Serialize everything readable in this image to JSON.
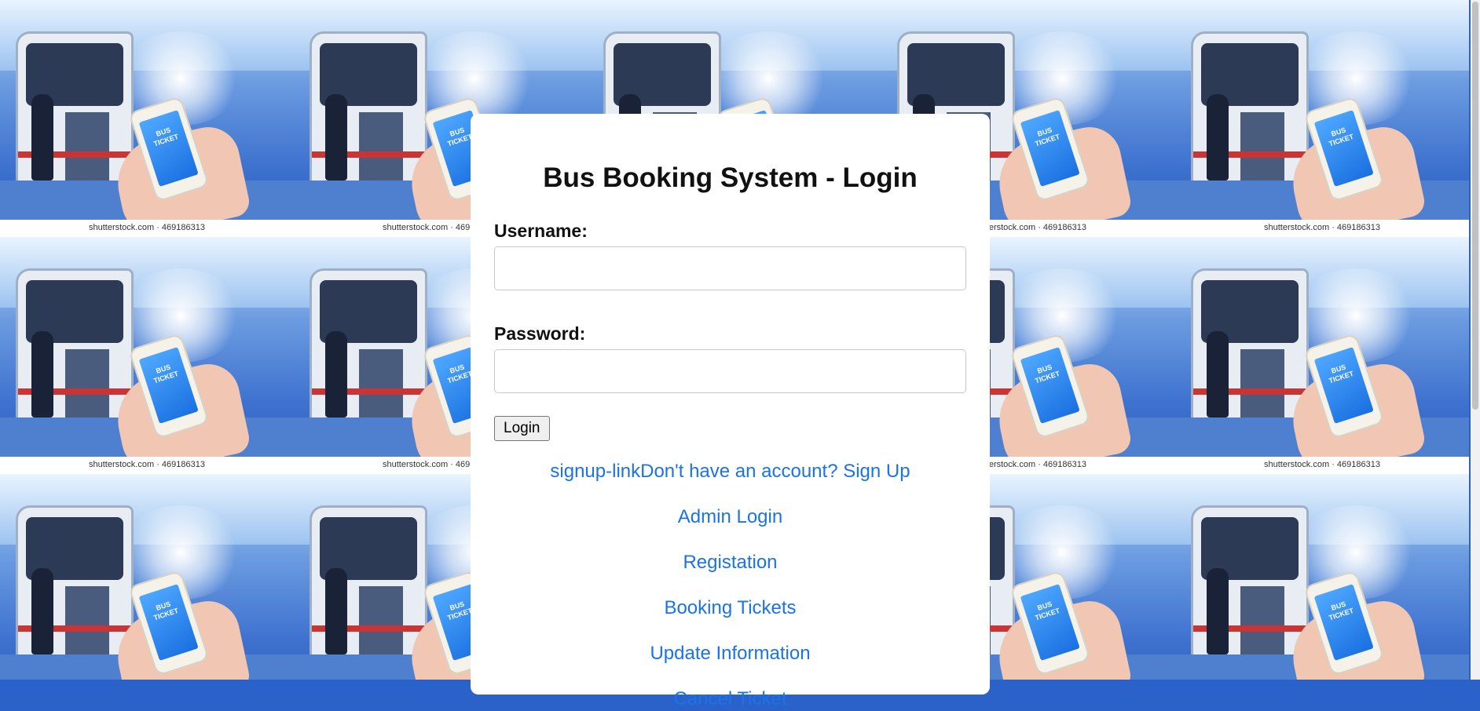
{
  "background": {
    "tile_caption": "shutterstock.com · 469186313",
    "phone_text": "BUS TICKET"
  },
  "login": {
    "title": "Bus Booking System - Login",
    "username_label": "Username:",
    "username_value": "",
    "password_label": "Password:",
    "password_value": "",
    "login_button": "Login"
  },
  "links": {
    "signup": "signup-linkDon't have an account? Sign Up",
    "admin_login": "Admin Login",
    "registation": "Registation",
    "booking_tickets": "Booking Tickets",
    "update_information": "Update Information",
    "cancel_ticket": "Cancel Ticket"
  },
  "colors": {
    "link": "#1a73e8",
    "card": "#ffffff"
  }
}
